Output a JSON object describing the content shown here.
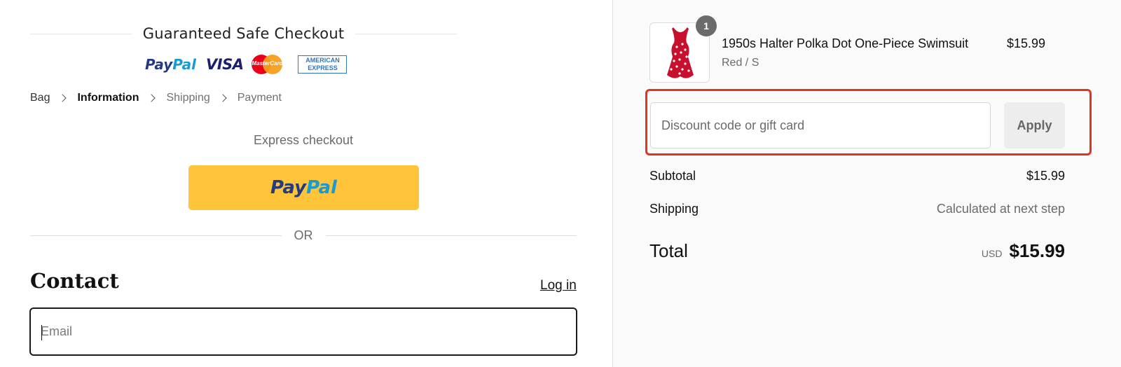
{
  "header": {
    "safe_checkout_title": "Guaranteed Safe Checkout",
    "payment_logos": [
      "PayPal",
      "VISA",
      "MasterCard",
      "AMERICAN EXPRESS"
    ]
  },
  "breadcrumb": [
    {
      "label": "Bag",
      "state": "done"
    },
    {
      "label": "Information",
      "state": "current"
    },
    {
      "label": "Shipping",
      "state": "upcoming"
    },
    {
      "label": "Payment",
      "state": "upcoming"
    }
  ],
  "express": {
    "label": "Express checkout",
    "paypal_button": "PayPal"
  },
  "divider": {
    "or": "OR"
  },
  "contact": {
    "title": "Contact",
    "login_link": "Log in",
    "email_placeholder": "Email"
  },
  "order": {
    "item": {
      "quantity_badge": "1",
      "name": "1950s Halter Polka Dot One-Piece Swimsuit",
      "variant": "Red / S",
      "price": "$15.99"
    },
    "discount": {
      "placeholder": "Discount code or gift card",
      "apply_label": "Apply",
      "highlight_color": "#e5341d"
    },
    "subtotal": {
      "label": "Subtotal",
      "value": "$15.99"
    },
    "shipping": {
      "label": "Shipping",
      "value": "Calculated at next step"
    },
    "total": {
      "label": "Total",
      "currency": "USD",
      "value": "$15.99"
    }
  },
  "colors": {
    "paypal_yellow": "#ffc439",
    "paypal_dark_blue": "#253b80",
    "paypal_light_blue": "#179bd7",
    "swimsuit_red": "#c8102e"
  }
}
